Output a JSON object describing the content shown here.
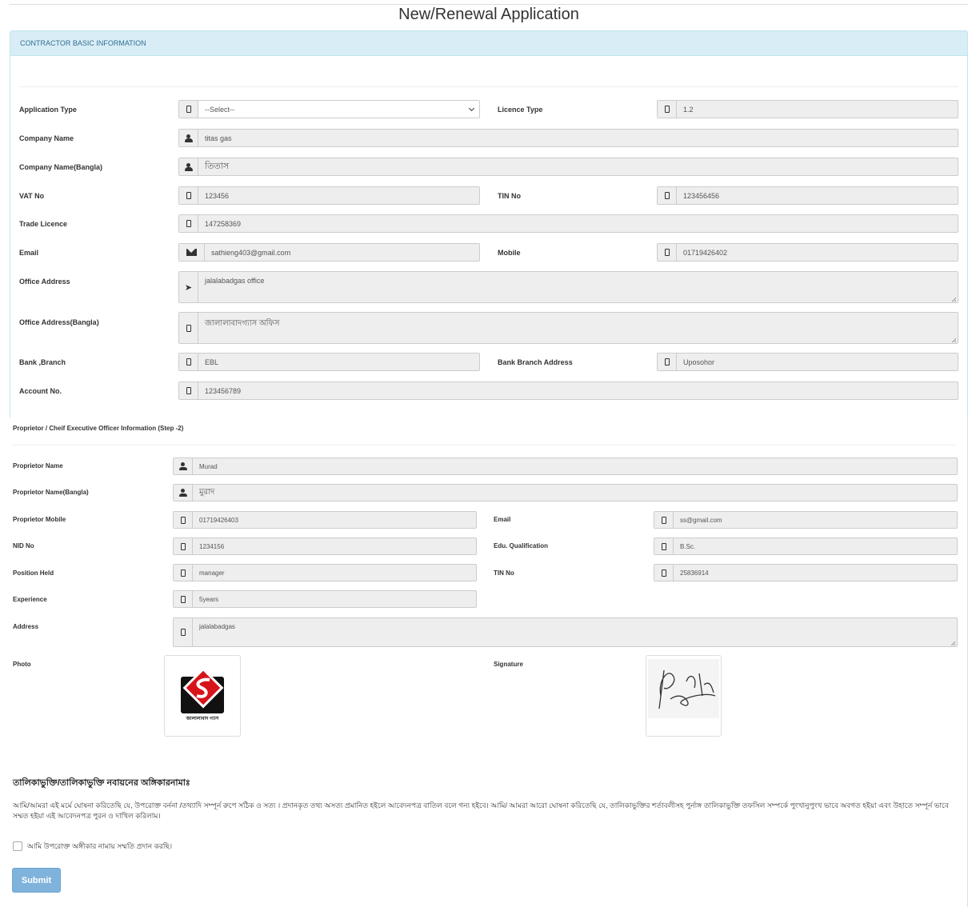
{
  "page_title": "New/Renewal Application",
  "basic": {
    "header": "CONTRACTOR BASIC INFORMATION",
    "application_type": {
      "label": "Application Type",
      "value": "--Select--"
    },
    "licence_type": {
      "label": "Licence Type",
      "value": "1.2"
    },
    "company_name": {
      "label": "Company Name",
      "value": "titas gas"
    },
    "company_name_bangla": {
      "label": "Company Name(Bangla)",
      "value": "তিতাস"
    },
    "vat_no": {
      "label": "VAT No",
      "value": "123456"
    },
    "tin_no": {
      "label": "TIN No",
      "value": "123456456"
    },
    "trade_licence": {
      "label": "Trade Licence",
      "value": "147258369"
    },
    "email": {
      "label": "Email",
      "value": "sathieng403@gmail.com"
    },
    "mobile": {
      "label": "Mobile",
      "value": "01719426402"
    },
    "office_address": {
      "label": "Office Address",
      "value": "jalalabadgas office"
    },
    "office_address_bangla": {
      "label": "Office Address(Bangla)",
      "value": "জালালাবাদগ্যাস অফিস"
    },
    "bank_branch": {
      "label": "Bank ,Branch",
      "value": "EBL"
    },
    "bank_branch_address": {
      "label": "Bank Branch Address",
      "value": "Uposohor"
    },
    "account_no": {
      "label": "Account No.",
      "value": "123456789"
    }
  },
  "proprietor": {
    "header": "Proprietor / Cheif Executive Officer Information (Step -2)",
    "name": {
      "label": "Proprietor Name",
      "value": "Murad"
    },
    "name_bangla": {
      "label": "Proprietor Name(Bangla)",
      "value": "মুরাদ"
    },
    "mobile": {
      "label": "Proprietor Mobile",
      "value": "01719426403"
    },
    "email": {
      "label": "Email",
      "value": "ss@gmail.com"
    },
    "nid": {
      "label": "NID No",
      "value": "1234156"
    },
    "qualification": {
      "label": "Edu. Qualification",
      "value": "B.Sc."
    },
    "position": {
      "label": "Position Held",
      "value": "manager"
    },
    "tin": {
      "label": "TIN No",
      "value": "25836914"
    },
    "experience": {
      "label": "Experience",
      "value": "5years"
    },
    "address": {
      "label": "Address",
      "value": "jalalabadgas"
    },
    "photo": {
      "label": "Photo",
      "logo_text": "জালালাবাদ গ্যাস"
    },
    "signature": {
      "label": "Signature"
    }
  },
  "declaration": {
    "title": "তালিকাভুক্তি/তালিকাভুক্তি নবায়নের অঙ্গিকারনামাঃ",
    "text": "আমি/আমরা এই মর্মে ঘোষনা করিতেছি যে, উপরোক্ত বর্ননা /তথ্যাদি সম্পূর্ন রুপে সঠিক ও সত্য । প্রদানকৃত তথ্য অসত্য প্রমানিত হইলে আবেদনপত্র বাতিল বলে গন্য হইবে। আমি/ আমরা আরো ঘোষনা করিতেছি যে, তালিকাভুক্তির শর্তাবলীসহ পুর্নাঙ্গ তালিকাভুক্তি তফসিল সম্পর্কে পুংখানুপুংখ ভাবে অবগত হইয়া এবং উহাতে সম্পূর্ন ভাবে সম্মত হইয়া এই আবেদনপত্র পুরন ও দাখিল করিলাম।",
    "checkbox_label": "আমি উপরোক্ত অঙ্গীকার নামায় সম্মতি প্রদান করছি।"
  },
  "submit_label": "Submit",
  "colors": {
    "panel_head_bg": "#d9edf7",
    "panel_head_text": "#31708f",
    "submit_bg": "#7fb3dc",
    "input_bg": "#eeeeee",
    "logo_red": "#d7141a"
  }
}
